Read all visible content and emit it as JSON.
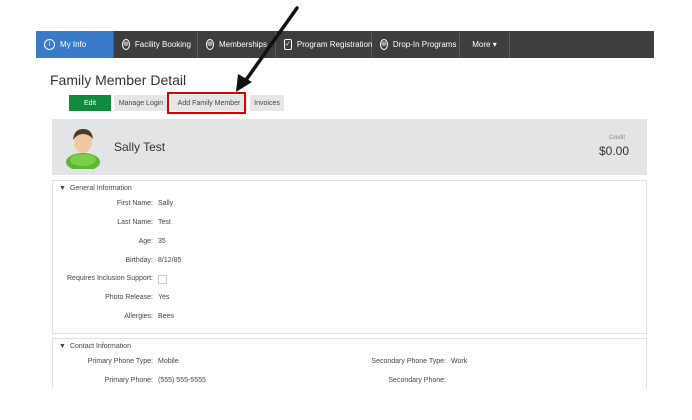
{
  "nav": {
    "items": [
      {
        "label": "My Info",
        "icon": "info-icon"
      },
      {
        "label": "Facility Booking",
        "icon": "globe-icon"
      },
      {
        "label": "Memberships",
        "icon": "globe-icon"
      },
      {
        "label": "Program Registration",
        "icon": "checkbox-icon"
      },
      {
        "label": "Drop-In Programs",
        "icon": "globe-icon"
      },
      {
        "label": "More ▾",
        "icon": ""
      }
    ],
    "active_color": "#3a7bc8"
  },
  "page": {
    "title": "Family Member Detail"
  },
  "actions": {
    "edit": "Edit",
    "manage_login": "Manage Login",
    "add_family_member": "Add Family Member",
    "invoices": "Invoices"
  },
  "profile": {
    "name": "Sally Test",
    "credit_label": "Credit",
    "credit_value": "$0.00"
  },
  "general": {
    "title": "General Information",
    "fields": [
      {
        "label": "First Name:",
        "value": "Sally"
      },
      {
        "label": "Last Name:",
        "value": "Test"
      },
      {
        "label": "Age:",
        "value": "35"
      },
      {
        "label": "Birthday:",
        "value": "8/12/85"
      },
      {
        "label": "Requires Inclusion Support:",
        "value": ""
      },
      {
        "label": "Photo Release:",
        "value": "Yes"
      },
      {
        "label": "Allergies:",
        "value": "Bees"
      }
    ]
  },
  "contact": {
    "title": "Contact Information",
    "primary_phone_type_label": "Primary Phone Type:",
    "primary_phone_type": "Mobile",
    "primary_phone_label": "Primary Phone:",
    "primary_phone": "(555) 555-5555",
    "secondary_phone_type_label": "Secondary Phone Type:",
    "secondary_phone_type": "Work",
    "secondary_phone_label": "Secondary Phone:",
    "secondary_phone": ""
  },
  "colors": {
    "edit_button": "#118a3e",
    "highlight": "#e00000"
  }
}
